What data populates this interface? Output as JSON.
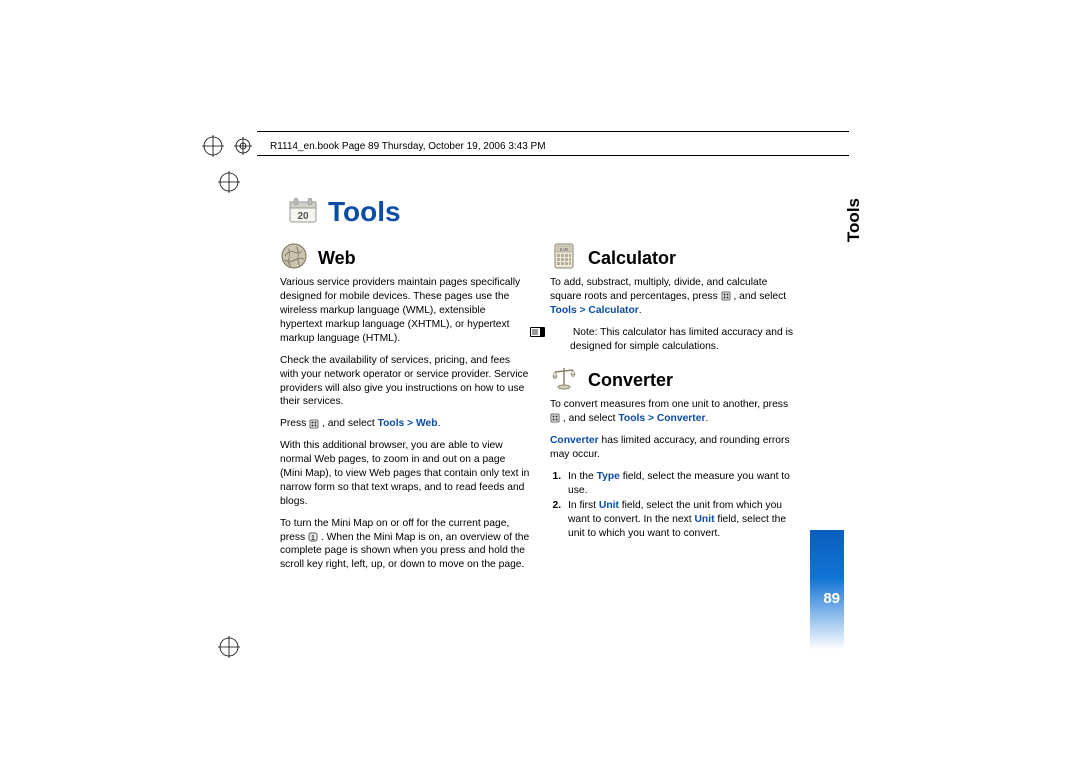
{
  "header": "R1114_en.book  Page 89  Thursday, October 19, 2006  3:43 PM",
  "section_tab": "Tools",
  "page_title": "Tools",
  "page_number": "89",
  "left": {
    "heading": "Web",
    "p1": "Various service providers maintain pages specifically designed for mobile devices. These pages use the wireless markup language (WML), extensible hypertext markup language (XHTML), or hypertext markup language (HTML).",
    "p2": "Check the availability of services, pricing, and fees with your network operator or service provider. Service providers will also give you instructions on how to use their services.",
    "p3a": "Press ",
    "p3b": " , and select ",
    "p3_link": "Tools > Web",
    "p3c": ".",
    "p4": "With this additional browser, you are able to view normal Web pages, to zoom in and out on a page (Mini Map), to view Web pages that contain only text in narrow form so that text wraps, and to read feeds and blogs.",
    "p5a": "To turn the Mini Map on or off for the current page, press ",
    "p5b": " . When the Mini Map is on, an overview of the complete page is shown when you press and hold the scroll key right, left, up, or down to move on the page."
  },
  "right": {
    "calc_heading": "Calculator",
    "calc_p1a": "To add, substract, multiply, divide, and calculate square roots and percentages, press ",
    "calc_p1b": " , and select ",
    "calc_link": "Tools > Calculator",
    "calc_p1c": ".",
    "note": "Note: This calculator has limited accuracy and is designed for simple calculations.",
    "conv_heading": "Converter",
    "conv_p1a": "To convert measures from one unit to another, press ",
    "conv_p1b": " , and select ",
    "conv_link": "Tools > Converter",
    "conv_p1c": ".",
    "conv_p2a": "Converter",
    "conv_p2b": " has limited accuracy, and rounding errors may occur.",
    "step1a": "In the ",
    "step1_type": "Type",
    "step1b": " field, select the measure you want to use.",
    "step2a": "In first ",
    "step2_unit1": "Unit",
    "step2b": " field, select the unit from which you want to convert. In the next ",
    "step2_unit2": "Unit",
    "step2c": " field, select the unit to which you want to convert."
  }
}
